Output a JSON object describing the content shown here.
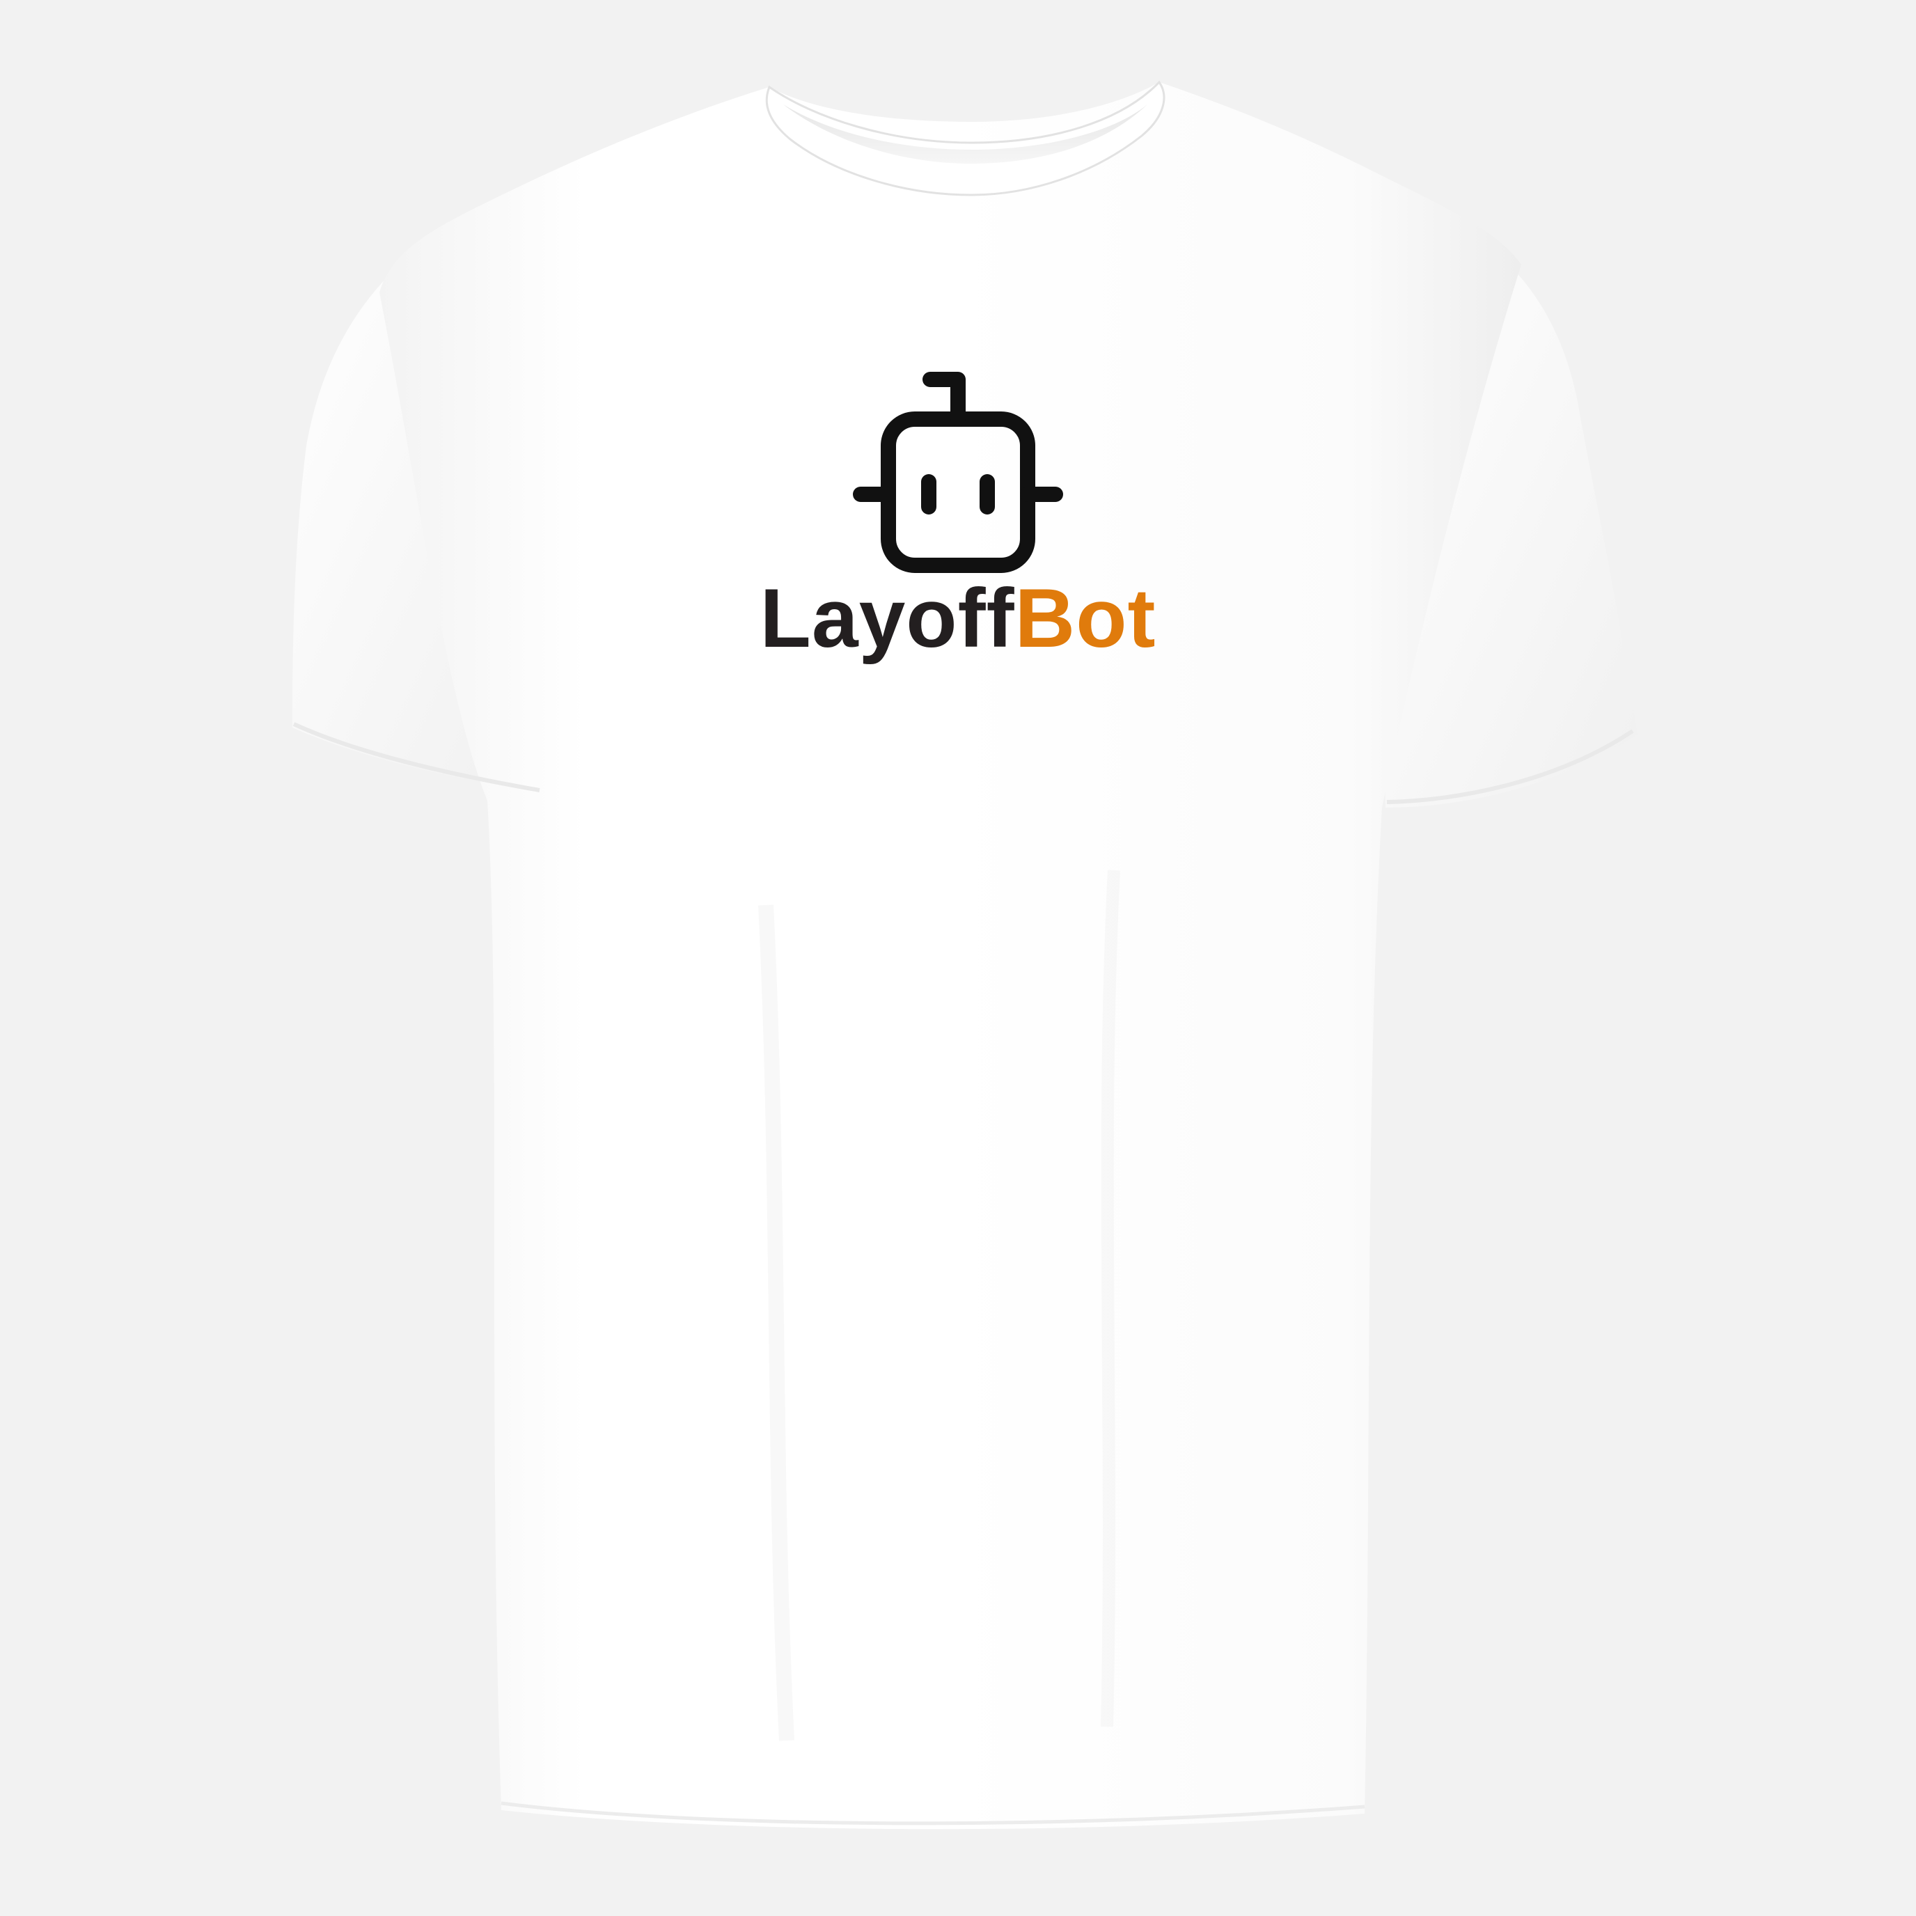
{
  "brand": {
    "part1": "Layoff",
    "part2": "Bot"
  },
  "colors": {
    "background": "#f2f2f2",
    "shirt": "#ffffff",
    "logo_icon": "#111111",
    "wordmark_dark": "#231f20",
    "wordmark_accent": "#e07b0c"
  },
  "icons": {
    "logo": "robot-icon"
  }
}
